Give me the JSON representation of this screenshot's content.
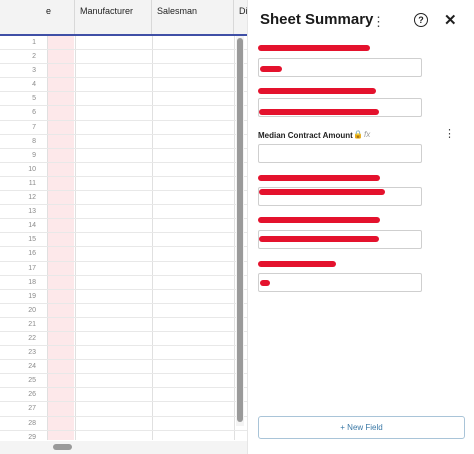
{
  "grid": {
    "columns": [
      "e",
      "Manufacturer",
      "Salesman",
      "Di"
    ],
    "row_numbers": [
      "1",
      "2",
      "3",
      "4",
      "5",
      "6",
      "7",
      "8",
      "9",
      "10",
      "11",
      "12",
      "13",
      "14",
      "15",
      "16",
      "17",
      "18",
      "19",
      "20",
      "21",
      "22",
      "23",
      "24",
      "25",
      "26",
      "27",
      "28",
      "29"
    ]
  },
  "panel": {
    "title": "Sheet Summary",
    "median_label": "Median Contract Amount",
    "fx_label": "fx",
    "new_field_label": "+ New Field",
    "help_glyph": "?",
    "close_glyph": "✕",
    "kebab_glyph": "⋮"
  },
  "colors": {
    "accent": "#3f4fa6",
    "redaction": "#e4122d",
    "highlight_column": "#fde8ea",
    "button_text": "#3a78a6"
  }
}
